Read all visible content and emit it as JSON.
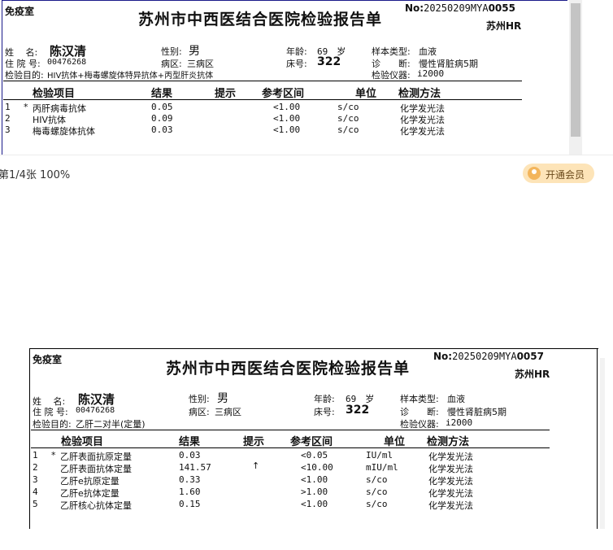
{
  "viewer": {
    "page_info": "第1/4张 100%",
    "vip_label": "开通会员"
  },
  "report1": {
    "dept": "免疫室",
    "title": "苏州市中西医结合医院检验报告单",
    "no_label": "No:",
    "no_value": "20250209MYA",
    "no_suffix": "0055",
    "sub_right": "苏州HR",
    "name_label": "姓　 名:",
    "name": "陈汉清",
    "gender_label": "性别:",
    "gender": "男",
    "age_label": "年龄:",
    "age": "69　岁",
    "sample_label": "样本类型:",
    "sample": "血液",
    "admission_label": "住 院 号:",
    "admission": "00476268",
    "ward_label": "病区:",
    "ward": "三病区",
    "bed_label": "床号:",
    "bed": "322",
    "diag_label": "诊　　断:",
    "diag": "慢性肾脏病5期",
    "purpose_label": "检验目的:",
    "purpose": "HIV抗体+梅毒螺旋体特异抗体+丙型肝炎抗体",
    "instrument_label": "检验仪器:",
    "instrument": "i2000",
    "columns": [
      "检验项目",
      "结果",
      "提示",
      "参考区间",
      "单位",
      "检测方法"
    ],
    "rows": [
      {
        "idx": "1",
        "star": "*",
        "item": "丙肝病毒抗体",
        "result": "0.05",
        "hint": "",
        "ref": "<1.00",
        "unit": "s/co",
        "method": "化学发光法"
      },
      {
        "idx": "2",
        "star": "",
        "item": "HIV抗体",
        "result": "0.09",
        "hint": "",
        "ref": "<1.00",
        "unit": "s/co",
        "method": "化学发光法"
      },
      {
        "idx": "3",
        "star": "",
        "item": "梅毒螺旋体抗体",
        "result": "0.03",
        "hint": "",
        "ref": "<1.00",
        "unit": "s/co",
        "method": "化学发光法"
      }
    ]
  },
  "report2": {
    "dept": "免疫室",
    "title": "苏州市中西医结合医院检验报告单",
    "no_label": "No:",
    "no_value": "20250209MYA",
    "no_suffix": "0057",
    "sub_right": "苏州HR",
    "name_label": "姓　 名:",
    "name": "陈汉清",
    "gender_label": "性别:",
    "gender": "男",
    "age_label": "年龄:",
    "age": "69　岁",
    "sample_label": "样本类型:",
    "sample": "血液",
    "admission_label": "住 院 号:",
    "admission": "00476268",
    "ward_label": "病区:",
    "ward": "三病区",
    "bed_label": "床号:",
    "bed": "322",
    "diag_label": "诊　　断:",
    "diag": "慢性肾脏病5期",
    "purpose_label": "检验目的:",
    "purpose": "乙肝二对半(定量)",
    "instrument_label": "检验仪器:",
    "instrument": "i2000",
    "columns": [
      "检验项目",
      "结果",
      "提示",
      "参考区间",
      "单位",
      "检测方法"
    ],
    "rows": [
      {
        "idx": "1",
        "star": "*",
        "item": "乙肝表面抗原定量",
        "result": "0.03",
        "hint": "",
        "ref": "<0.05",
        "unit": "IU/ml",
        "method": "化学发光法"
      },
      {
        "idx": "2",
        "star": "",
        "item": "乙肝表面抗体定量",
        "result": "141.57",
        "hint": "↑",
        "ref": "<10.00",
        "unit": "mIU/ml",
        "method": "化学发光法"
      },
      {
        "idx": "3",
        "star": "",
        "item": "乙肝e抗原定量",
        "result": "0.33",
        "hint": "",
        "ref": "<1.00",
        "unit": "s/co",
        "method": "化学发光法"
      },
      {
        "idx": "4",
        "star": "",
        "item": "乙肝e抗体定量",
        "result": "1.60",
        "hint": "",
        "ref": ">1.00",
        "unit": "s/co",
        "method": "化学发光法"
      },
      {
        "idx": "5",
        "star": "",
        "item": "乙肝核心抗体定量",
        "result": "0.15",
        "hint": "",
        "ref": "<1.00",
        "unit": "s/co",
        "method": "化学发光法"
      }
    ]
  }
}
